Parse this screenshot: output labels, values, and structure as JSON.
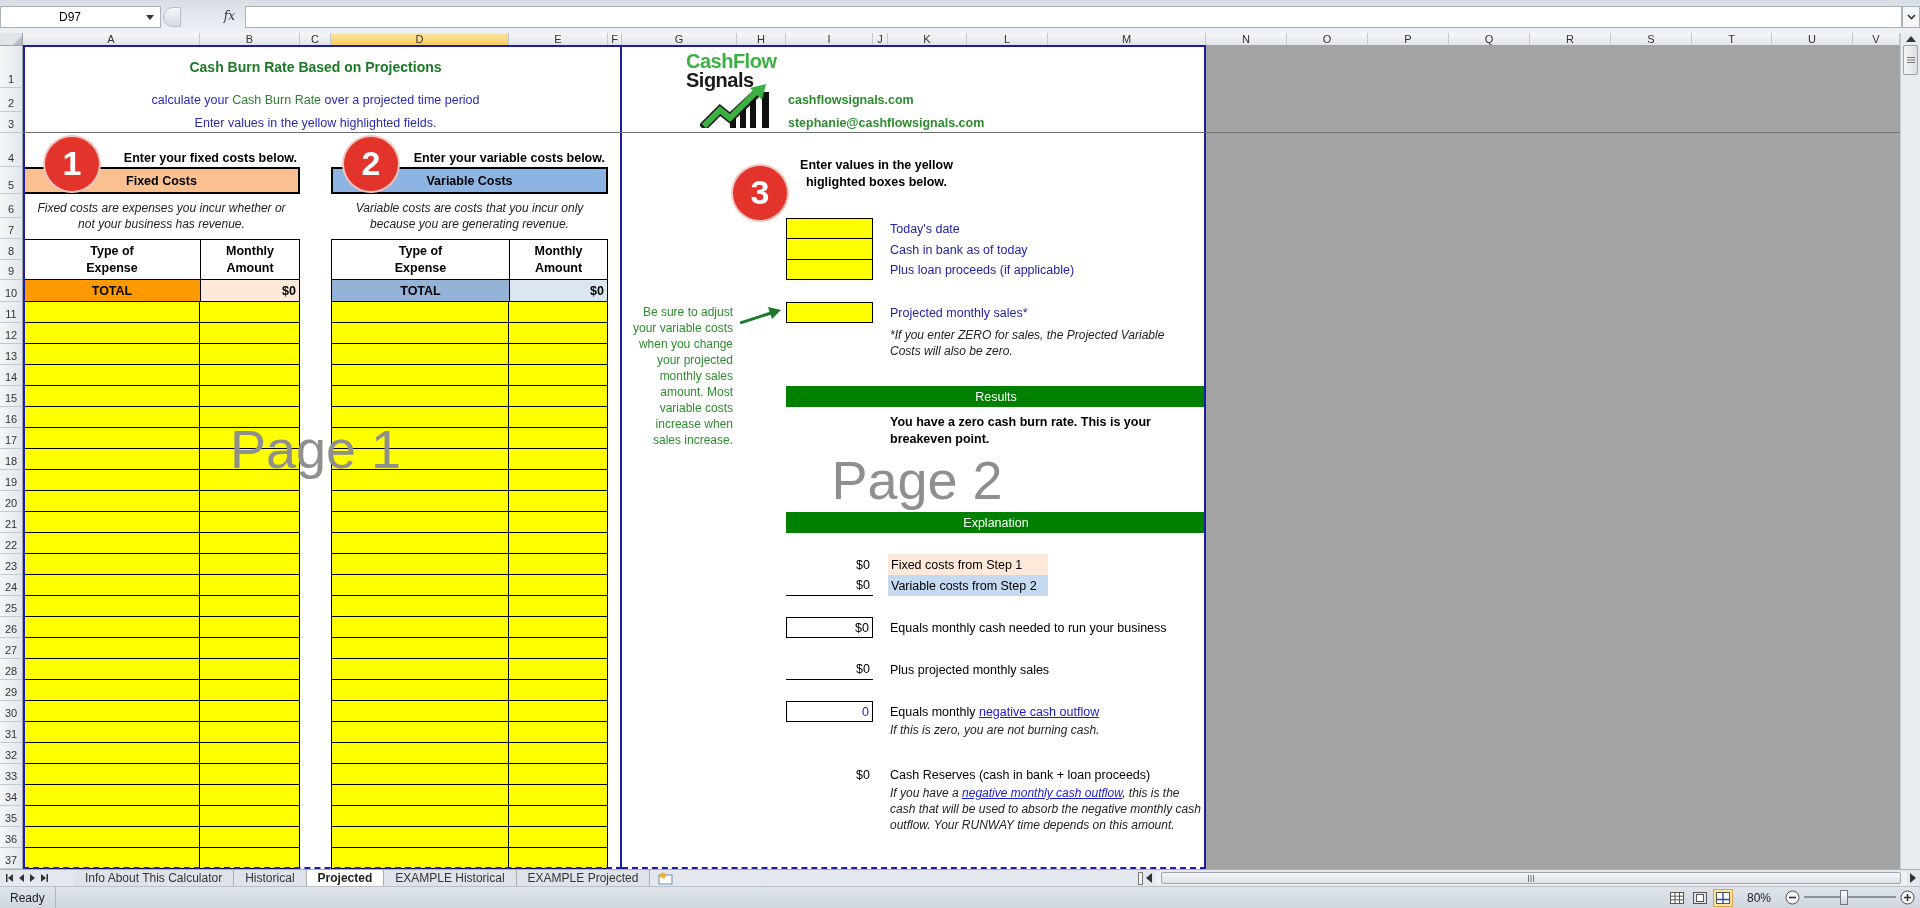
{
  "formula_bar": {
    "name_box": "D97",
    "function_label": "fx"
  },
  "column_headers": [
    {
      "label": "A",
      "selected": false
    },
    {
      "label": "B",
      "selected": false
    },
    {
      "label": "C",
      "selected": false
    },
    {
      "label": "D",
      "selected": true
    },
    {
      "label": "E",
      "selected": false
    },
    {
      "label": "F",
      "selected": false
    },
    {
      "label": "G",
      "selected": false
    },
    {
      "label": "H",
      "selected": false
    },
    {
      "label": "I",
      "selected": false
    },
    {
      "label": "J",
      "selected": false
    },
    {
      "label": "K",
      "selected": false
    },
    {
      "label": "L",
      "selected": false
    },
    {
      "label": "M",
      "selected": false
    },
    {
      "label": "N",
      "selected": false
    },
    {
      "label": "O",
      "selected": false
    },
    {
      "label": "P",
      "selected": false
    },
    {
      "label": "Q",
      "selected": false
    },
    {
      "label": "R",
      "selected": false
    },
    {
      "label": "S",
      "selected": false
    },
    {
      "label": "T",
      "selected": false
    },
    {
      "label": "U",
      "selected": false
    },
    {
      "label": "V",
      "selected": false
    }
  ],
  "row_numbers": [
    "1",
    "2",
    "3",
    "4",
    "5",
    "6",
    "7",
    "8",
    "9",
    "10",
    "11",
    "12",
    "13",
    "14",
    "15",
    "16",
    "17",
    "18",
    "19",
    "20",
    "21",
    "22",
    "23",
    "24",
    "25",
    "26",
    "27",
    "28",
    "29",
    "30",
    "31",
    "32",
    "33",
    "34",
    "35",
    "36",
    "37"
  ],
  "header": {
    "title": "Cash Burn Rate Based on Projections",
    "subtitle": {
      "before": "calculate your ",
      "highlight": "Cash Burn Rate",
      "after": " over a projected time period"
    },
    "instruction": "Enter values in the yellow highlighted fields."
  },
  "logo": {
    "top": "CashFlow",
    "bottom": "Signals"
  },
  "contact": [
    "cashflowsignals.com",
    "stephanie@cashflowsignals.com"
  ],
  "cost_tables": [
    {
      "kind": "fixed",
      "number": "1",
      "prompt": "Enter your fixed costs below.",
      "heading": "Fixed Costs",
      "description_lines": [
        "Fixed costs are expenses you incur whether or",
        "not your business has revenue."
      ],
      "columns": [
        "Type of Expense",
        "Monthly Amount"
      ],
      "total_label": "TOTAL",
      "total_value": "$0"
    },
    {
      "kind": "variable",
      "number": "2",
      "prompt": "Enter your variable costs below.",
      "heading": "Variable Costs",
      "description_lines": [
        "Variable costs are costs that you incur only",
        "because you are generating revenue."
      ],
      "columns": [
        "Type of Expense",
        "Monthly Amount"
      ],
      "total_label": "TOTAL",
      "total_value": "$0"
    }
  ],
  "inputs_section": {
    "number": "3",
    "prompt_lines": [
      "Enter values in the yellow",
      "higlighted boxes below."
    ],
    "fields": [
      {
        "label": "Today's date"
      },
      {
        "label": "Cash in bank as of today"
      },
      {
        "label": "Plus loan proceeds (if applicable)"
      },
      {
        "label": "Projected monthly sales*"
      }
    ],
    "sales_note_lines": [
      "*If you enter ZERO for sales, the Projected Variable",
      "Costs will also be zero."
    ],
    "side_note_lines": [
      "Be sure to adjust",
      "your variable costs",
      "when you change",
      "your projected",
      "monthly sales",
      "amount. Most",
      "variable costs",
      "increase when",
      "sales increase."
    ]
  },
  "results": {
    "heading": "Results",
    "message_lines": [
      "You have a zero cash burn rate. This is your",
      "breakeven point."
    ]
  },
  "explanation": {
    "heading": "Explanation",
    "lines": [
      {
        "value": "$0",
        "underlined": false,
        "boxed": false,
        "is_link": false,
        "label": "Fixed costs from Step 1",
        "label_box": {
          "color": "#fde9d9"
        }
      },
      {
        "value": "$0",
        "underlined": true,
        "boxed": false,
        "is_link": false,
        "label": "Variable costs from Step 2",
        "label_box": {
          "color": "#c5d9f1"
        }
      },
      {
        "value": "$0",
        "underlined": false,
        "boxed": true,
        "is_link": false,
        "label": "Equals monthly cash needed to run your business"
      },
      {
        "value": "$0",
        "underlined": true,
        "boxed": false,
        "is_link": false,
        "label": "Plus projected monthly sales"
      },
      {
        "value": "0",
        "underlined": false,
        "boxed": true,
        "is_link": true,
        "label": "Equals monthly ",
        "link": "negative cash outflow",
        "note": {
          "before": "If this is zero, you are not burning cash."
        }
      },
      {
        "value": "$0",
        "underlined": false,
        "boxed": false,
        "is_link": false,
        "label": "Cash Reserves (cash in bank + loan proceeds)",
        "note": {
          "before": "If you have a ",
          "link": "negative monthly cash outflow",
          "after": ", this is the cash that will be used to absorb the negative monthly cash outflow. Your RUNWAY time depends on this amount."
        }
      }
    ]
  },
  "page_labels": [
    "Page 1",
    "Page 2"
  ],
  "sheet_tabs": [
    {
      "label": "Info About This Calculator",
      "selected": false
    },
    {
      "label": "Historical",
      "selected": false
    },
    {
      "label": "Projected",
      "selected": true
    },
    {
      "label": "EXAMPLE Historical",
      "selected": false
    },
    {
      "label": "EXAMPLE Projected",
      "selected": false
    }
  ],
  "status_bar": {
    "status": "Ready",
    "views": [
      {
        "kind": "normal",
        "selected": false
      },
      {
        "kind": "page_layout",
        "selected": false
      },
      {
        "kind": "page_break",
        "selected": true
      }
    ],
    "zoom_label": "80%",
    "zoom_slider": {
      "level": 0.43
    }
  }
}
